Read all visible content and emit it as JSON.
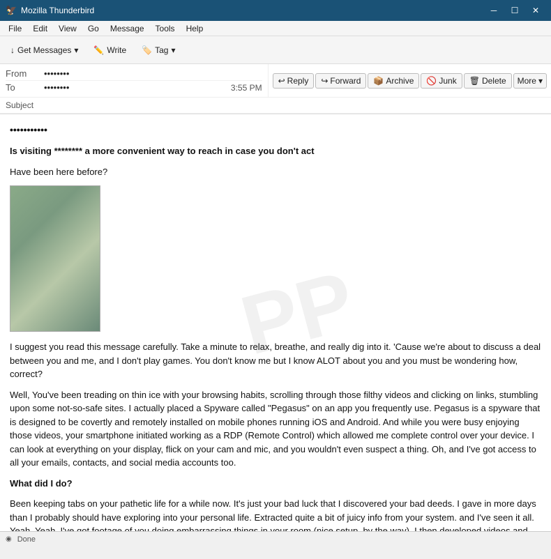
{
  "titleBar": {
    "icon": "🦅",
    "title": "Mozilla Thunderbird",
    "minimizeLabel": "─",
    "maximizeLabel": "☐",
    "closeLabel": "✕"
  },
  "menuBar": {
    "items": [
      "File",
      "Edit",
      "View",
      "Go",
      "Message",
      "Tools",
      "Help"
    ]
  },
  "toolbar": {
    "getMessages": "Get Messages",
    "write": "Write",
    "tag": "Tag",
    "dropdownArrow": "▾"
  },
  "actionButtons": {
    "reply": "Reply",
    "forward": "Forward",
    "archive": "Archive",
    "junk": "Junk",
    "delete": "Delete",
    "more": "More",
    "moreArrow": "▾"
  },
  "emailHeader": {
    "fromLabel": "From",
    "fromValue": "••••••••",
    "toLabel": "To",
    "toValue": "••••••••",
    "time": "3:55 PM",
    "subjectLabel": "Subject"
  },
  "emailBody": {
    "senderMasked": "•••••••••••",
    "headline": "Is visiting ******** a more convenient way to reach in case you don't act",
    "intro": "Have been here before?",
    "para1": "I suggest you read this message carefully. Take a minute to relax, breathe, and really dig into it. 'Cause we're about to discuss a deal between you and me, and I don't play games. You don't know me but I know ALOT about you and you must be wondering how, correct?",
    "para2": "Well, You've been treading on thin ice with your browsing habits, scrolling through those filthy videos and clicking on links, stumbling upon some not-so-safe sites. I actually placed a Spyware called \"Pegasus\" on an app you frequently use. Pegasus is a spyware that is designed to be covertly and remotely installed on mobile phones running iOS and Android. And while you were busy enjoying those videos, your smartphone initiated working as a RDP (Remote Control) which allowed me complete control over your device. I can look at everything on your display, flick on your cam and mic, and you wouldn't even suspect a thing. Oh, and I've got access to all your emails, contacts, and social media accounts too.",
    "boldHeader": "What did I do?",
    "para3": "Been keeping tabs on your pathetic life for a while now. It's just your bad luck that I discovered your bad deeds. I gave in more days than I probably should have exploring into your personal life. Extracted quite a bit of juicy info from your system. and I've seen it all. Yeah, Yeah, I've got footage of you doing embarrassing things in your room (nice setup, by the way). I then developed videos and screenshots where on one side of the screen, there's whatever garbage you had been playing, and on the other half, its someone"
  },
  "statusBar": {
    "icon": "◉",
    "text": "Done"
  }
}
